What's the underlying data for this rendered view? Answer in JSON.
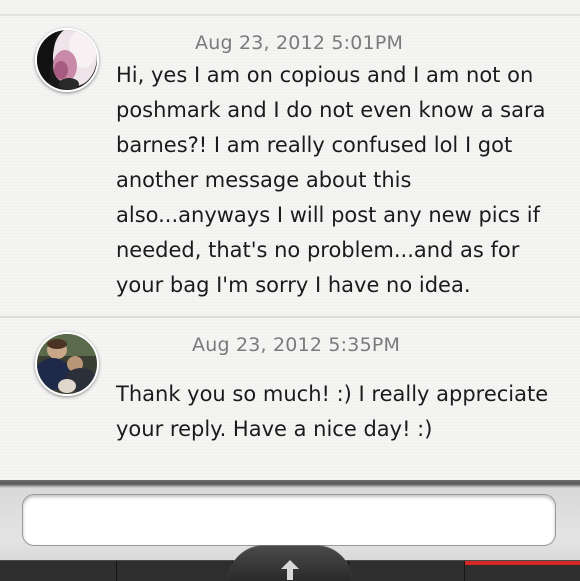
{
  "messages": [
    {
      "timestamp": "Aug 23, 2012 5:01PM",
      "body": "Hi, yes I am on copious and I  am not on poshmark and I do not even know a sara barnes?! I am really confused lol I got another message about this also...anyways I will post any new pics if needed, that's no problem...and as for your bag I'm sorry I have no idea."
    },
    {
      "timestamp": "Aug 23, 2012 5:35PM",
      "body": "Thank you so much! :) I really appreciate your reply. Have a nice day! :)"
    }
  ],
  "composer": {
    "value": "",
    "placeholder": ""
  },
  "toolbar": {
    "home_icon": "up-arrow-icon",
    "active_accent": "#d62626"
  }
}
